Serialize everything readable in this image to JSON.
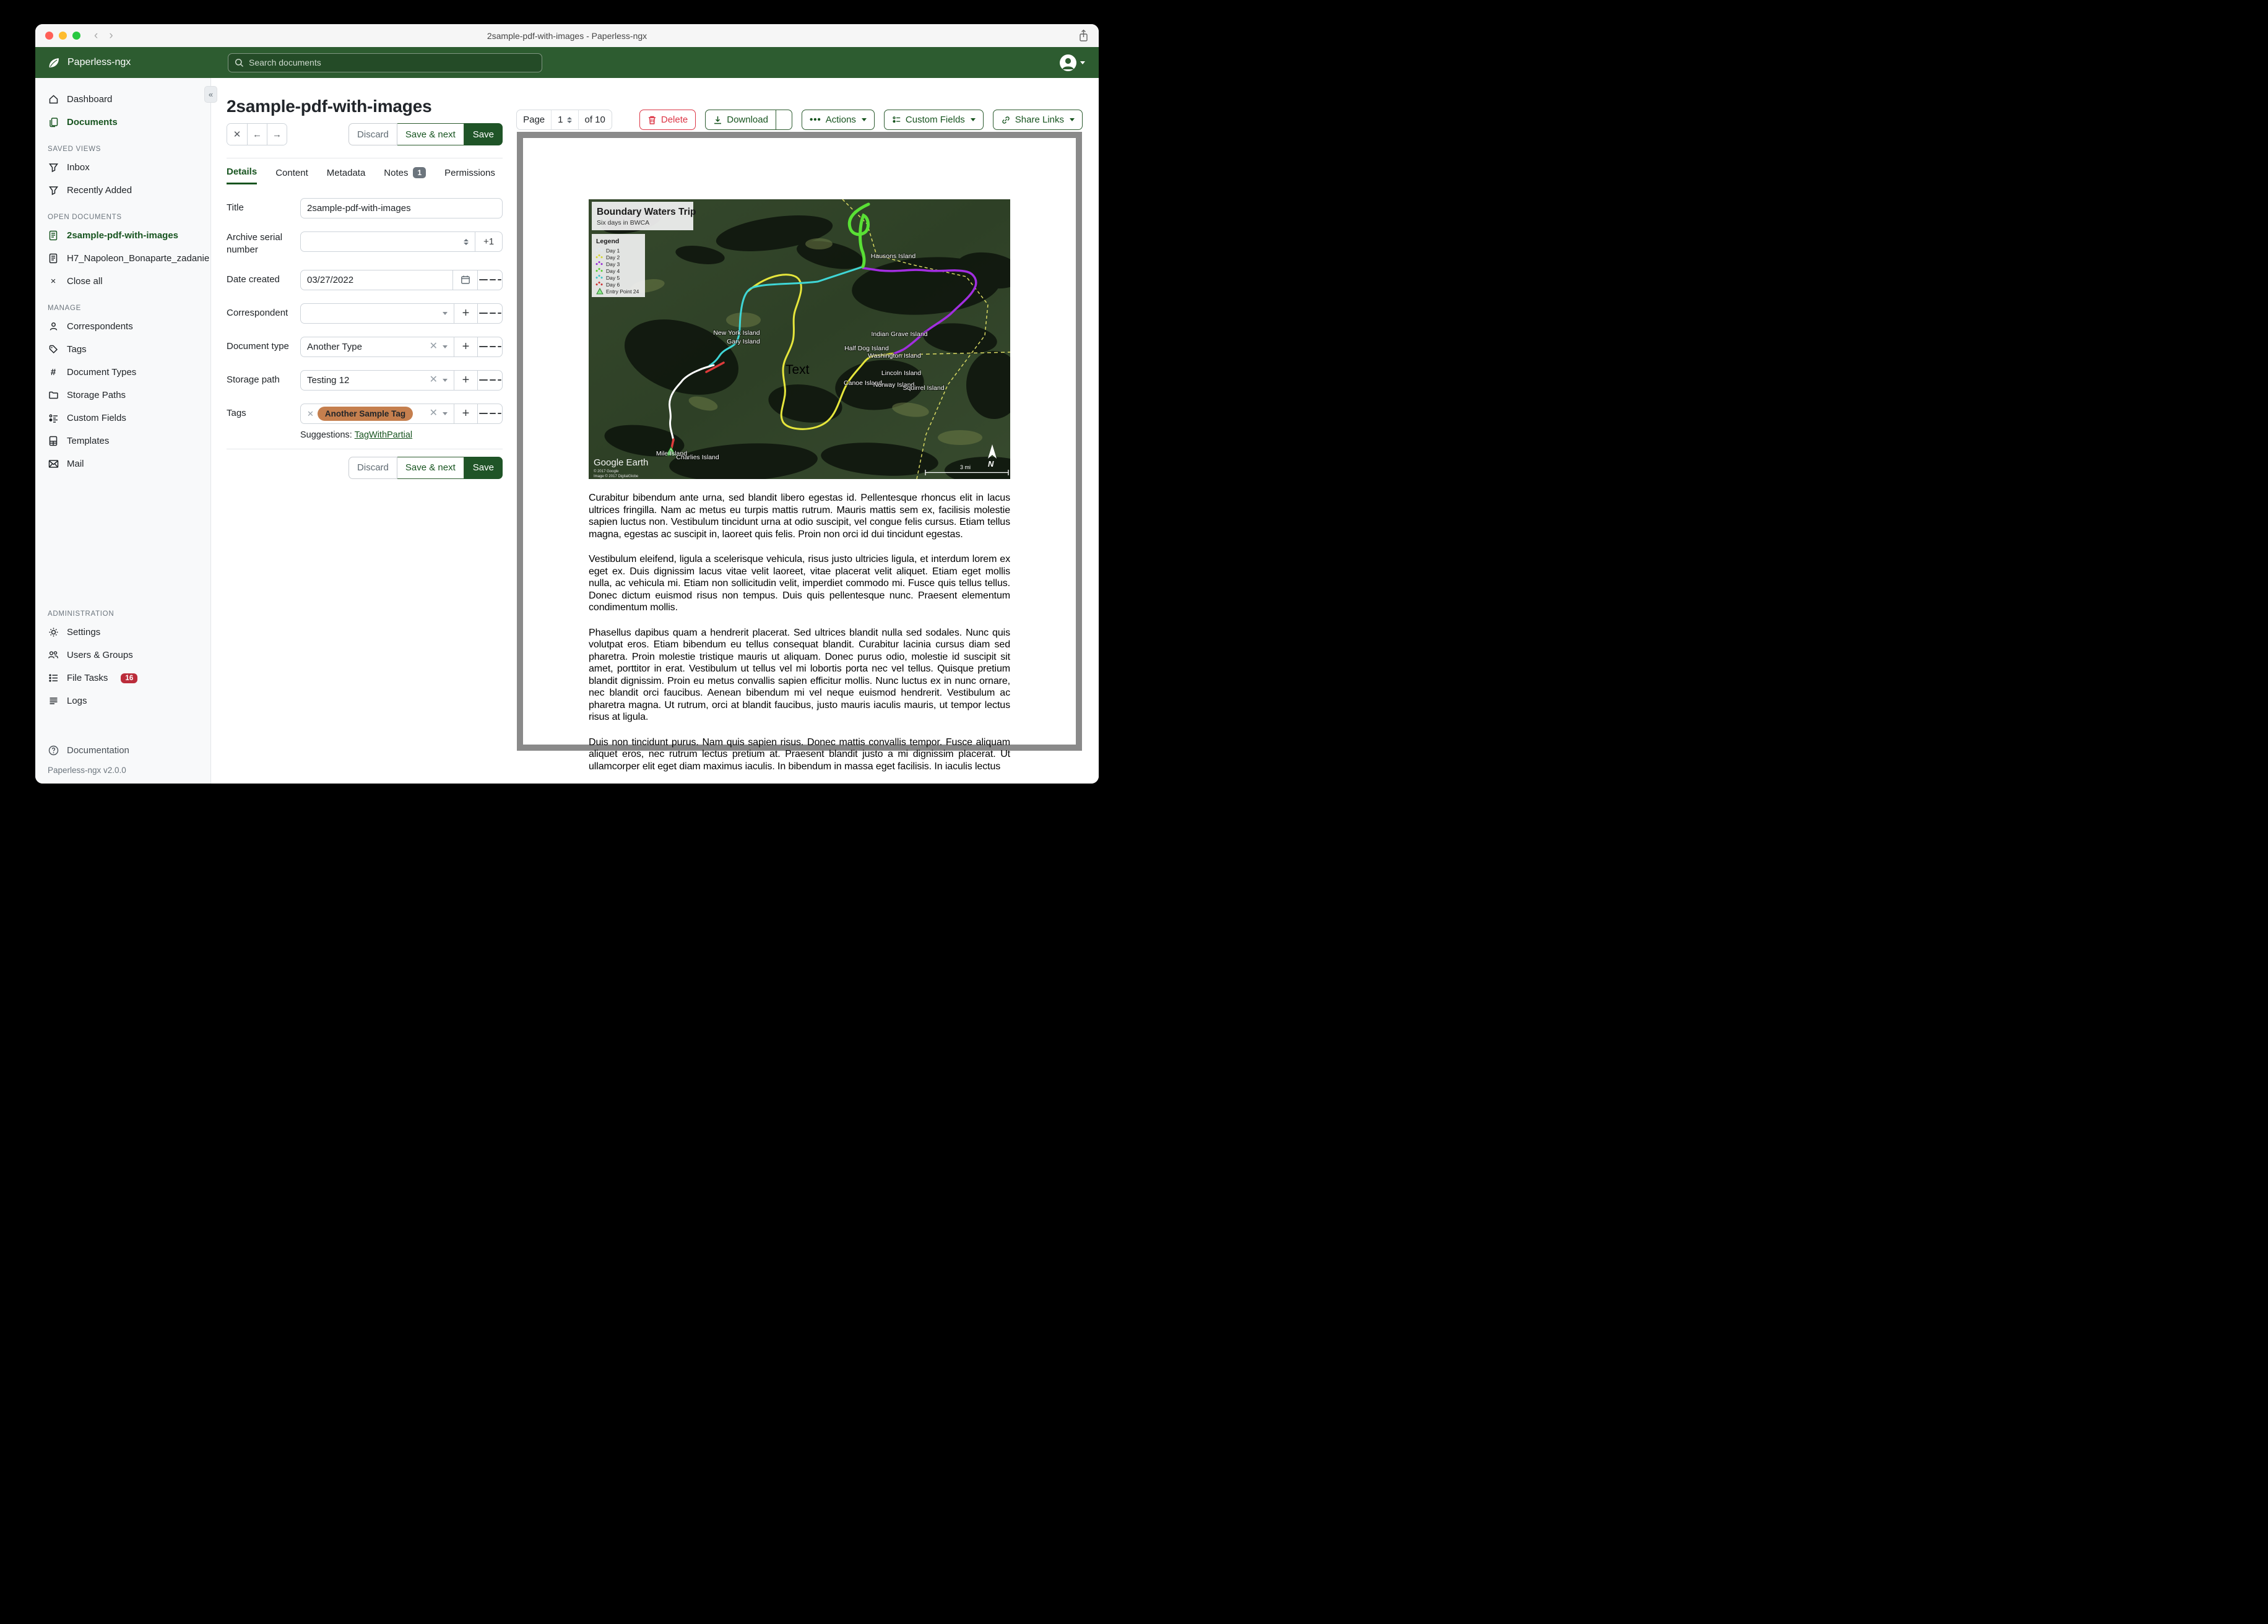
{
  "window": {
    "title": "2sample-pdf-with-images - Paperless-ngx"
  },
  "header": {
    "brand": "Paperless-ngx",
    "search_placeholder": "Search documents"
  },
  "sidebar": {
    "collapse_glyph": "«",
    "dashboard": "Dashboard",
    "documents": "Documents",
    "saved_views_title": "SAVED VIEWS",
    "inbox": "Inbox",
    "recently_added": "Recently Added",
    "open_documents_title": "OPEN DOCUMENTS",
    "open_doc_1": "2sample-pdf-with-images",
    "open_doc_2": "H7_Napoleon_Bonaparte_zadanie",
    "close_all": "Close all",
    "manage_title": "MANAGE",
    "correspondents": "Correspondents",
    "tags": "Tags",
    "document_types": "Document Types",
    "storage_paths": "Storage Paths",
    "custom_fields": "Custom Fields",
    "templates": "Templates",
    "mail": "Mail",
    "administration_title": "ADMINISTRATION",
    "settings": "Settings",
    "users_groups": "Users & Groups",
    "file_tasks": "File Tasks",
    "file_tasks_badge": "16",
    "logs": "Logs",
    "documentation": "Documentation",
    "version": "Paperless-ngx v2.0.0"
  },
  "toolbar": {
    "page_label": "Page",
    "page_value": "1",
    "page_of": "of 10",
    "delete": "Delete",
    "download": "Download",
    "actions": "Actions",
    "custom_fields": "Custom Fields",
    "share_links": "Share Links"
  },
  "doc": {
    "title": "2sample-pdf-with-images",
    "tabs": {
      "details": "Details",
      "content": "Content",
      "metadata": "Metadata",
      "notes": "Notes",
      "notes_badge": "1",
      "permissions": "Permissions"
    },
    "buttons": {
      "discard": "Discard",
      "save_next": "Save & next",
      "save": "Save"
    },
    "form": {
      "title": {
        "label": "Title",
        "value": "2sample-pdf-with-images"
      },
      "asn": {
        "label": "Archive serial number",
        "value": "",
        "plus_one": "+1"
      },
      "date_created": {
        "label": "Date created",
        "value": "03/27/2022"
      },
      "correspondent": {
        "label": "Correspondent",
        "value": ""
      },
      "document_type": {
        "label": "Document type",
        "value": "Another Type"
      },
      "storage_path": {
        "label": "Storage path",
        "value": "Testing 12"
      },
      "tags": {
        "label": "Tags",
        "chip": "Another Sample Tag",
        "chip_color": "#c57f4e"
      },
      "suggestions_label": "Suggestions:",
      "suggestion_link": "TagWithPartial"
    }
  },
  "preview": {
    "map": {
      "title": "Boundary Waters Trip",
      "subtitle": "Six days in BWCA",
      "legend_title": "Legend",
      "legend_items": [
        {
          "label": "Day 1",
          "color": "#dfe8ee"
        },
        {
          "label": "Day 2",
          "color": "#d6d632"
        },
        {
          "label": "Day 3",
          "color": "#9a2fd6"
        },
        {
          "label": "Day 4",
          "color": "#59cc31"
        },
        {
          "label": "Day 5",
          "color": "#3ec6c6"
        },
        {
          "label": "Day 6",
          "color": "#cc3434"
        },
        {
          "label": "Entry Point 24",
          "color": "#8ae88a"
        }
      ],
      "routes": {
        "day1": "#ffffff",
        "day2": "#e6e63c",
        "day3": "#a22ee0",
        "day4": "#59e035",
        "day5": "#3fd6d6",
        "day6": "#de3b3b",
        "border": "#d8d862"
      },
      "islands": [
        "Hausons Island",
        "New York Island",
        "Gary Island",
        "Indian Grave Island",
        "Half Dog Island",
        "Washington Island",
        "Lincoln Island",
        "Canoe Island",
        "Norway Island",
        "Squirrel Island",
        "Mile Island",
        "Charlies Island"
      ],
      "text_label": "Text",
      "credit": "Google Earth",
      "copyright1": "© 2017 Google",
      "copyright2": "Image © 2017 DigitalGlobe",
      "scale": "3 mi",
      "compass": "N"
    },
    "paragraphs": [
      "Curabitur bibendum ante urna, sed blandit libero egestas id. Pellentesque rhoncus elit in lacus ultrices fringilla. Nam ac metus eu turpis mattis rutrum. Mauris mattis sem ex, facilisis molestie sapien luctus non. Vestibulum tincidunt urna at odio suscipit, vel congue felis cursus. Etiam tellus magna, egestas ac suscipit in, laoreet quis felis. Proin non orci id dui tincidunt egestas.",
      "Vestibulum eleifend, ligula a scelerisque vehicula, risus justo ultricies ligula, et interdum lorem ex eget ex. Duis dignissim lacus vitae velit laoreet, vitae placerat velit aliquet. Etiam eget mollis nulla, ac vehicula mi. Etiam non sollicitudin velit, imperdiet commodo mi. Fusce quis tellus tellus. Donec dictum euismod risus non tempus. Duis quis pellentesque nunc. Praesent elementum condimentum mollis.",
      "Phasellus dapibus quam a hendrerit placerat. Sed ultrices blandit nulla sed sodales. Nunc quis volutpat eros. Etiam bibendum eu tellus consequat blandit. Curabitur lacinia cursus diam sed pharetra. Proin molestie tristique mauris ut aliquam. Donec purus odio, molestie id suscipit sit amet, porttitor in erat. Vestibulum ut tellus vel mi lobortis porta nec vel tellus. Quisque pretium blandit dignissim. Proin eu metus convallis sapien efficitur mollis. Nunc luctus ex in nunc ornare, nec blandit orci faucibus. Aenean bibendum mi vel neque euismod hendrerit. Vestibulum ac pharetra magna. Ut rutrum, orci at blandit faucibus, justo mauris iaculis mauris, ut tempor lectus risus at ligula.",
      "Duis non tincidunt purus. Nam quis sapien risus. Donec mattis convallis tempor. Fusce aliquam aliquet eros, nec rutrum lectus pretium at. Praesent blandit justo a mi dignissim placerat. Ut ullamcorper elit eget diam maximus iaculis. In bibendum in massa eget facilisis. In iaculis lectus"
    ]
  }
}
